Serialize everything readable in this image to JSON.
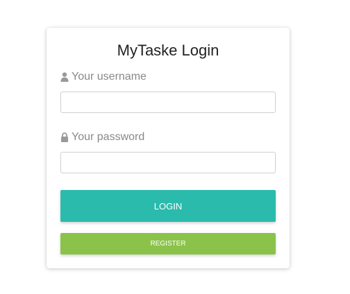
{
  "login_card": {
    "title": "MyTaske Login",
    "username": {
      "label": "Your username",
      "icon": "user-icon",
      "value": "",
      "placeholder": ""
    },
    "password": {
      "label": "Your password",
      "icon": "lock-icon",
      "value": "",
      "placeholder": ""
    },
    "login_button": "LOGIN",
    "register_button": "REGISTER"
  },
  "colors": {
    "login_button": "#2bbbad",
    "register_button": "#8bc34a",
    "label_text": "#888888"
  }
}
